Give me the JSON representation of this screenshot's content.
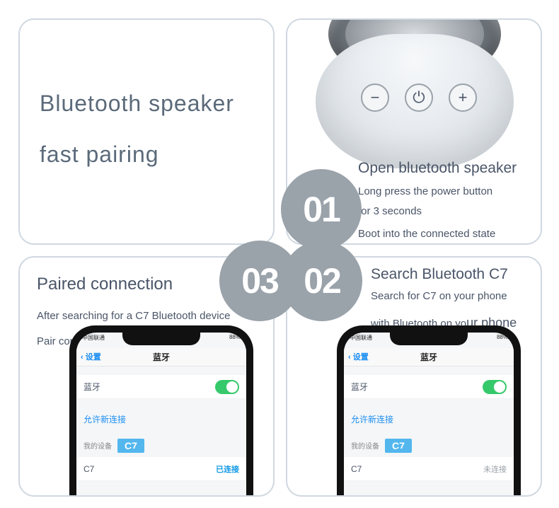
{
  "title": {
    "line1": "Bluetooth speaker",
    "line2": "fast pairing"
  },
  "steps": {
    "s01": {
      "num": "01",
      "title": "Open bluetooth speaker",
      "l1": "Long press the power button",
      "l2": "for 3 seconds",
      "l3": "Boot into the connected state"
    },
    "s02": {
      "num": "02",
      "title": "Search Bluetooth C7",
      "l1": "Search for C7 on your phone",
      "l2a": "with Bluetooth on yo",
      "l2b": "ur phone"
    },
    "s03": {
      "num": "03",
      "title": "Paired connection",
      "l1": "After searching for a C7 Bluetooth device",
      "l2": "Pair connection"
    }
  },
  "speaker_buttons": {
    "minus": "−",
    "power": "⏻",
    "plus": "+"
  },
  "phone": {
    "carrier": "中国联通",
    "battery": "88%",
    "back": "设置",
    "nav_title": "蓝牙",
    "bt_label": "蓝牙",
    "allow_label": "允许新连接",
    "mydev_label": "我的设备",
    "tag": "C7",
    "device_name": "C7",
    "connected": "已连接",
    "not_connected": "未连接"
  }
}
